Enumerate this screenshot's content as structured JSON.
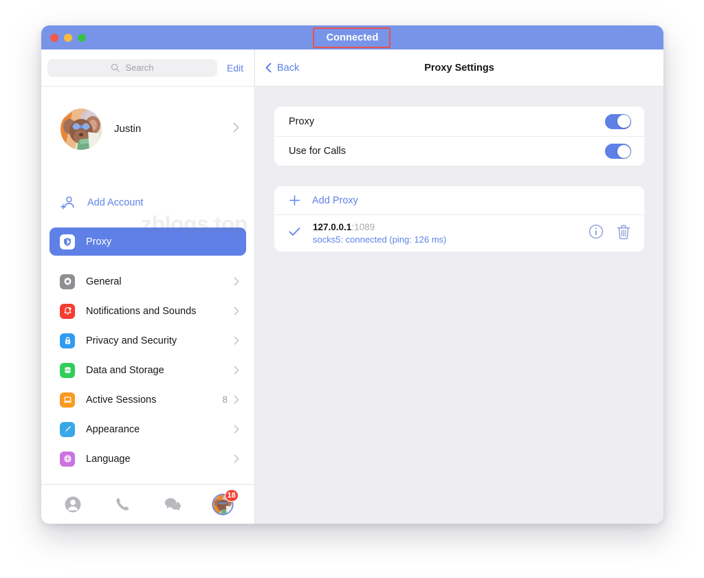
{
  "window": {
    "title": "Connected",
    "traffic_lights": [
      "close",
      "minimize",
      "zoom"
    ],
    "annotation_color": "#e8534a"
  },
  "sidebar": {
    "search": {
      "placeholder": "Search",
      "icon": "search-icon"
    },
    "edit_label": "Edit",
    "profile": {
      "name": "Justin",
      "avatar": "cartoon-mouse-avatar",
      "chevron": "chevron-right-icon"
    },
    "watermark": "zblogs.top",
    "add_account": {
      "label": "Add Account",
      "icon": "add-person-icon",
      "color": "#5f82e8"
    },
    "selected_item": {
      "label": "Proxy",
      "icon": "shield-icon",
      "highlight_color": "#5f80e6"
    },
    "items": [
      {
        "label": "General",
        "icon": "gear-icon",
        "color": "#8e8e93",
        "badge": "",
        "chevron": "chevron-right-icon"
      },
      {
        "label": "Notifications and Sounds",
        "icon": "bell-icon",
        "color": "#f53c30",
        "badge": "",
        "chevron": "chevron-right-icon"
      },
      {
        "label": "Privacy and Security",
        "icon": "lock-icon",
        "color": "#2f9cf4",
        "badge": "",
        "chevron": "chevron-right-icon"
      },
      {
        "label": "Data and Storage",
        "icon": "database-icon",
        "color": "#32cd5a",
        "badge": "",
        "chevron": "chevron-right-icon"
      },
      {
        "label": "Active Sessions",
        "icon": "laptop-icon",
        "color": "#fa9a20",
        "badge": "8",
        "chevron": "chevron-right-icon"
      },
      {
        "label": "Appearance",
        "icon": "paintbrush-icon",
        "color": "#38a8e8",
        "badge": "",
        "chevron": "chevron-right-icon"
      },
      {
        "label": "Language",
        "icon": "globe-icon",
        "color": "#c濾",
        "badge": "",
        "chevron": "chevron-right-icon"
      }
    ],
    "tabs": [
      {
        "name": "contacts",
        "icon": "person-circle-icon",
        "badge": ""
      },
      {
        "name": "calls",
        "icon": "phone-icon",
        "badge": ""
      },
      {
        "name": "chats",
        "icon": "speech-bubbles-icon",
        "badge": ""
      },
      {
        "name": "settings",
        "icon": "avatar-icon",
        "badge": "18"
      }
    ]
  },
  "main": {
    "back_label": "Back",
    "back_icon": "chevron-left-icon",
    "title": "Proxy Settings",
    "switches": [
      {
        "label": "Proxy",
        "value": "on"
      },
      {
        "label": "Use for Calls",
        "value": "on"
      }
    ],
    "add_proxy": {
      "label": "Add Proxy",
      "icon": "plus-icon"
    },
    "proxy_entries": [
      {
        "selected": true,
        "check_icon": "check-icon",
        "host": "127.0.0.1",
        "port": ":1089",
        "status": "socks5: connected (ping: 126 ms)",
        "info_icon": "info-circle-icon",
        "delete_icon": "trash-icon"
      }
    ]
  }
}
